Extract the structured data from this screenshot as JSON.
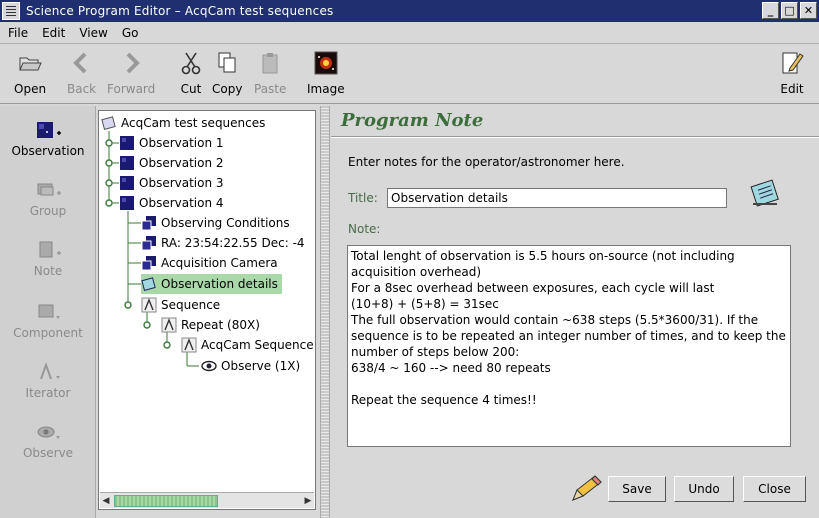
{
  "window": {
    "title": "Science Program Editor – AcqCam test sequences",
    "buttons": [
      "_",
      "□",
      "✕"
    ]
  },
  "menubar": {
    "items": [
      "File",
      "Edit",
      "View",
      "Go"
    ]
  },
  "toolbar": {
    "open": "Open",
    "back": "Back",
    "forward": "Forward",
    "cut": "Cut",
    "copy": "Copy",
    "paste": "Paste",
    "image": "Image",
    "edit": "Edit"
  },
  "palette": {
    "observation": "Observation",
    "group": "Group",
    "note": "Note",
    "component": "Component",
    "iterator": "Iterator",
    "observe": "Observe"
  },
  "tree": {
    "root": "AcqCam test sequences",
    "obs1": "Observation 1",
    "obs2": "Observation 2",
    "obs3": "Observation 3",
    "obs4": "Observation 4",
    "conditions": "Observing Conditions",
    "target": "RA: 23:54:22.55  Dec: -4",
    "camera": "Acquisition Camera",
    "details": "Observation details",
    "sequence": "Sequence",
    "repeat": "Repeat (80X)",
    "acqseq": "AcqCam Sequence",
    "observe": "Observe (1X)"
  },
  "note_editor": {
    "heading": "Program Note",
    "intro": "Enter notes for the operator/astronomer here.",
    "title_label": "Title:",
    "title_value": "Observation details",
    "note_label": "Note:",
    "note_text": "Total lenght of observation is 5.5 hours on-source (not including acquisition overhead)\nFor a 8sec overhead between exposures, each cycle will last\n(10+8) + (5+8) = 31sec\nThe full observation would contain ~638 steps (5.5*3600/31). If the sequence is to be repeated an integer number of times, and to keep the number of steps below 200:\n638/4 ~ 160 --> need 80 repeats\n\nRepeat the sequence 4 times!!",
    "save": "Save",
    "undo": "Undo",
    "close": "Close"
  },
  "icons": {
    "tree_leaf": "observation-icon",
    "selection_color": "#a9d8a9",
    "heading_color": "#3c6e3c",
    "titlebar_color": "#1f2f6f"
  }
}
